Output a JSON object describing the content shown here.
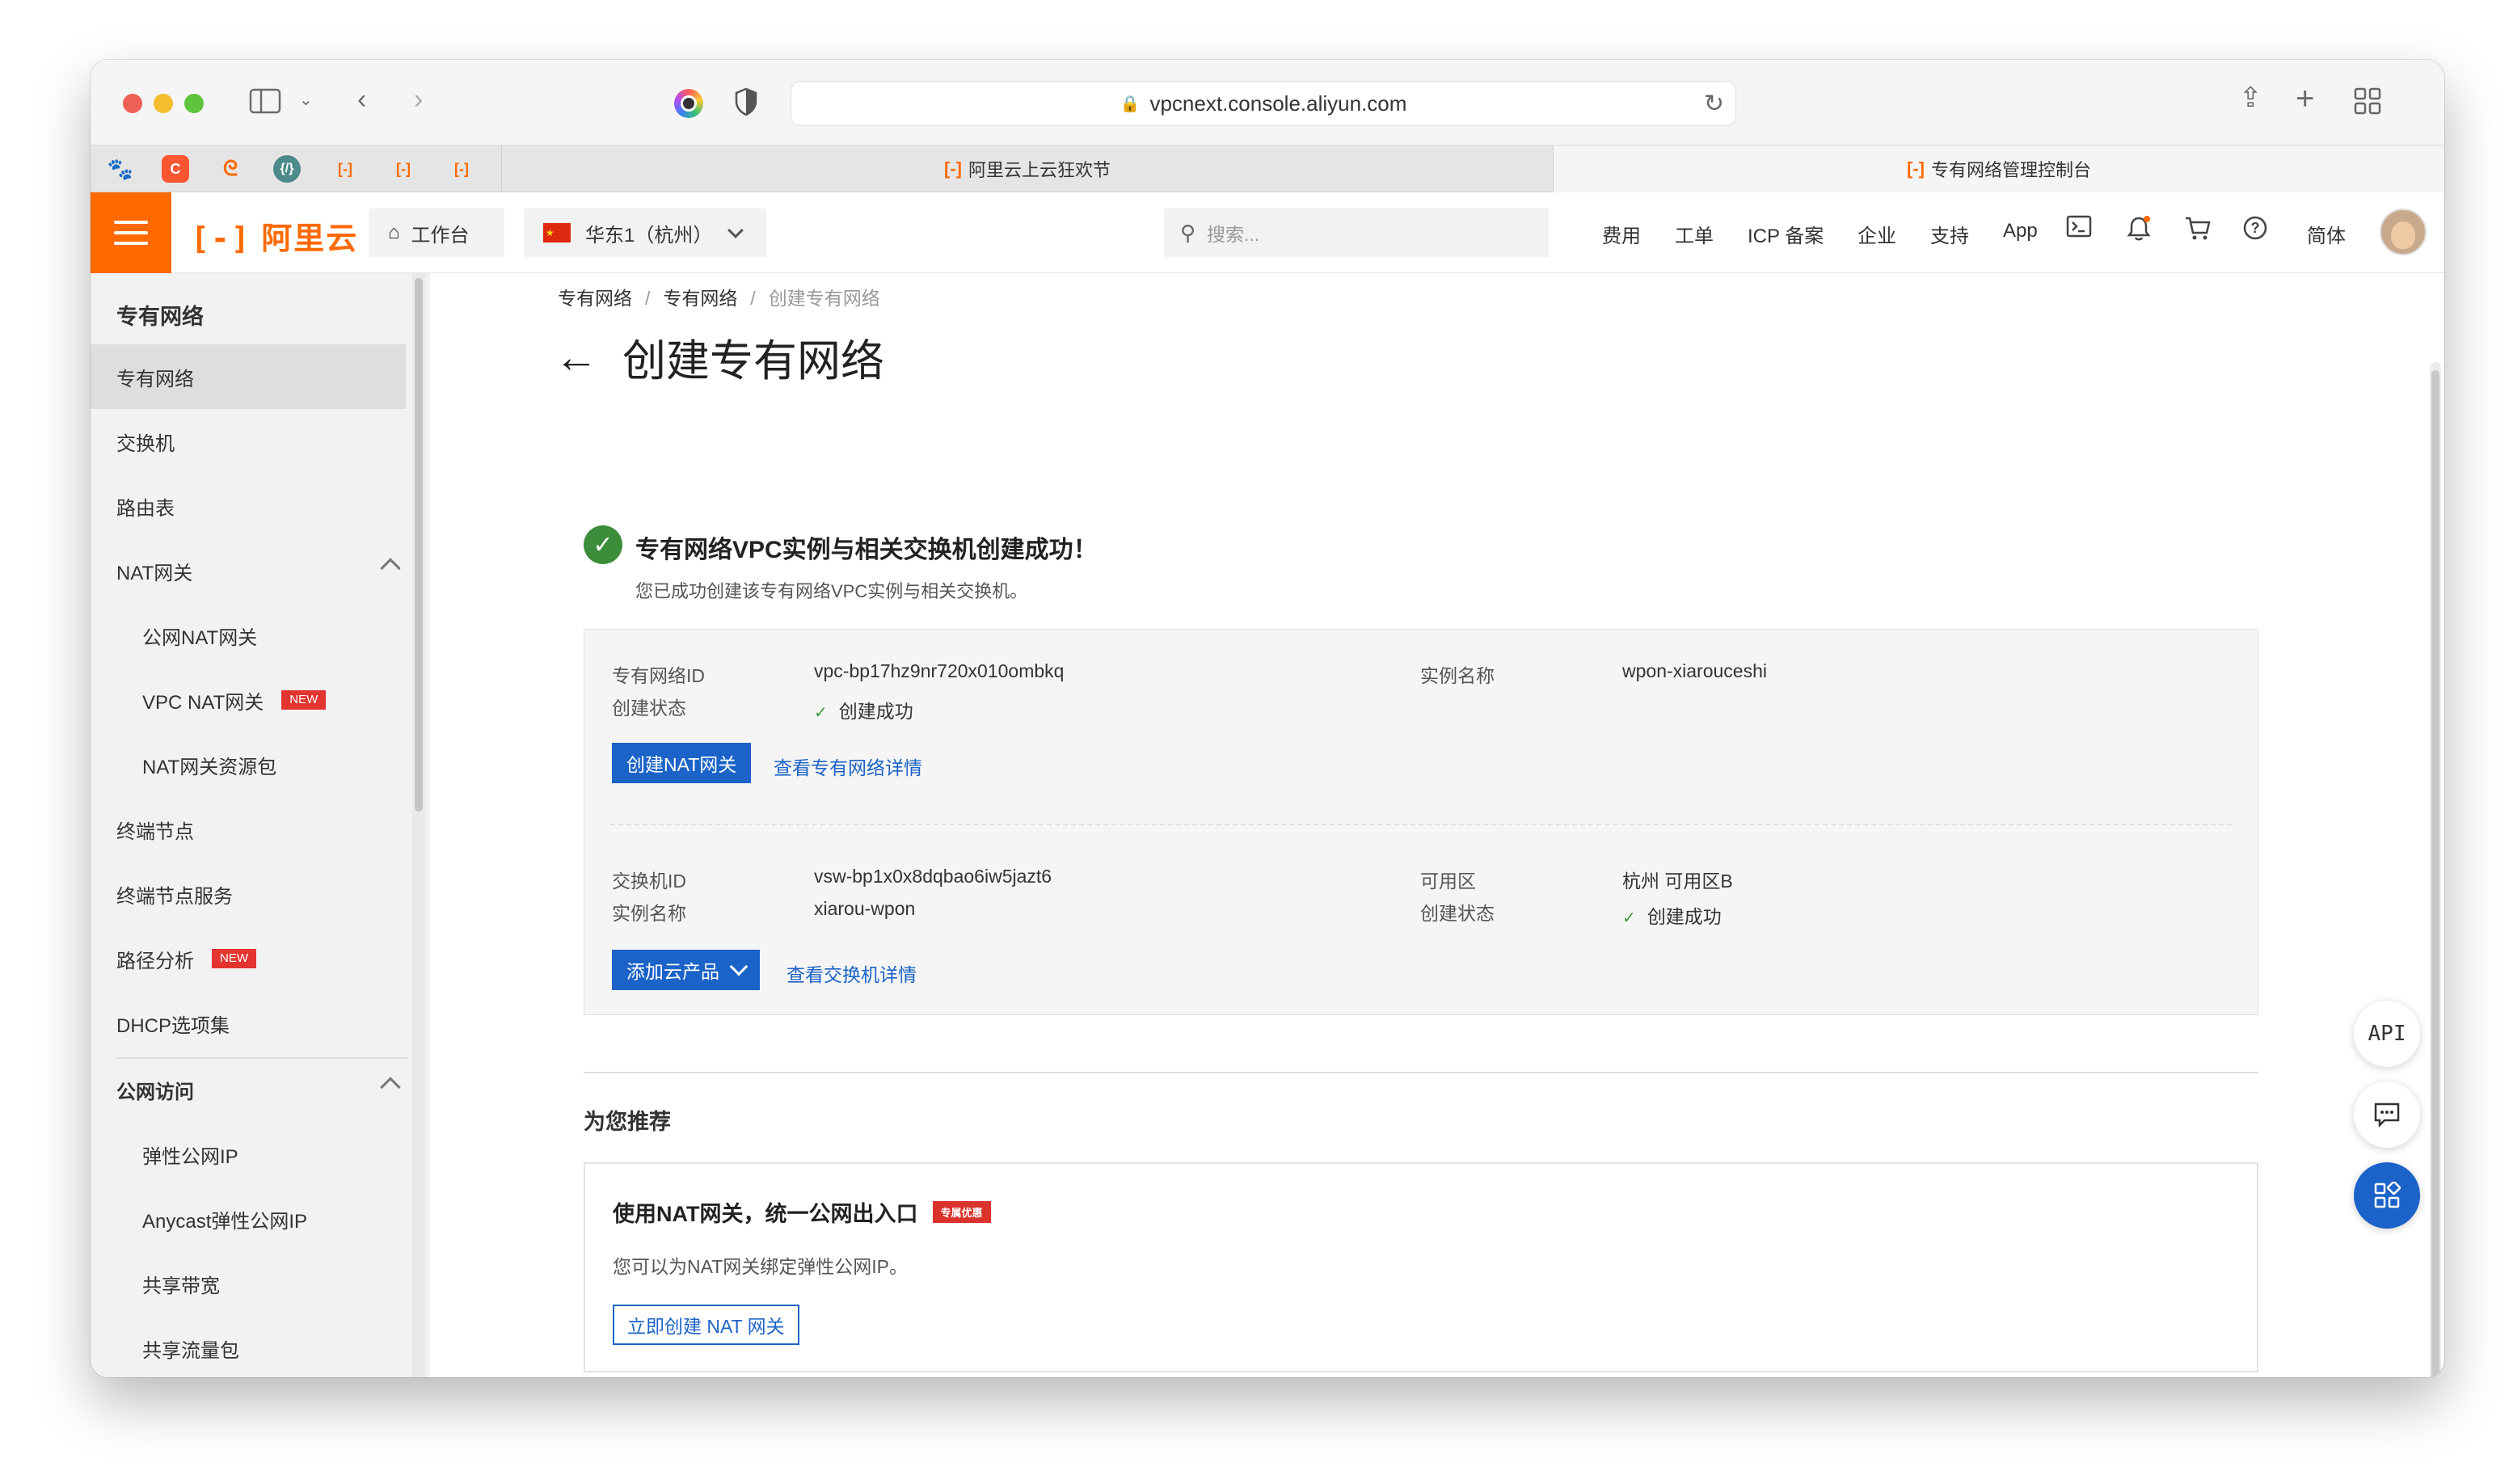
{
  "browser": {
    "url": "vpcnext.console.aliyun.com",
    "tabs": [
      {
        "label": "阿里云上云狂欢节",
        "active": false
      },
      {
        "label": "专有网络管理控制台",
        "active": true
      }
    ]
  },
  "header": {
    "logo": "阿里云",
    "workbench": "工作台",
    "region": "华东1（杭州）",
    "search_placeholder": "搜索...",
    "nav": [
      "费用",
      "工单",
      "ICP 备案",
      "企业",
      "支持",
      "App"
    ],
    "lang": "简体"
  },
  "sidebar": {
    "title": "专有网络",
    "items": [
      {
        "label": "专有网络",
        "level": 0,
        "active": true
      },
      {
        "label": "交换机",
        "level": 0
      },
      {
        "label": "路由表",
        "level": 0
      },
      {
        "label": "NAT网关",
        "level": 0,
        "expandable": true
      },
      {
        "label": "公网NAT网关",
        "level": 1
      },
      {
        "label": "VPC NAT网关",
        "level": 1,
        "badge": "NEW"
      },
      {
        "label": "NAT网关资源包",
        "level": 1
      },
      {
        "label": "终端节点",
        "level": 0
      },
      {
        "label": "终端节点服务",
        "level": 0
      },
      {
        "label": "路径分析",
        "level": 0,
        "badge": "NEW"
      },
      {
        "label": "DHCP选项集",
        "level": 0
      },
      {
        "label": "公网访问",
        "level": 0,
        "expandable": true
      },
      {
        "label": "弹性公网IP",
        "level": 1
      },
      {
        "label": "Anycast弹性公网IP",
        "level": 1
      },
      {
        "label": "共享带宽",
        "level": 1
      },
      {
        "label": "共享流量包",
        "level": 1
      }
    ]
  },
  "breadcrumb": [
    "专有网络",
    "专有网络",
    "创建专有网络"
  ],
  "page": {
    "title": "创建专有网络",
    "success_title": "专有网络VPC实例与相关交换机创建成功！",
    "success_desc": "您已成功创建该专有网络VPC实例与相关交换机。"
  },
  "vpc": {
    "id_label": "专有网络ID",
    "id": "vpc-bp17hz9nr720x010ombkq",
    "status_label": "创建状态",
    "status": "创建成功",
    "name_label": "实例名称",
    "name": "wpon-xiarouceshi",
    "create_nat_button": "创建NAT网关",
    "detail_link": "查看专有网络详情"
  },
  "vswitch": {
    "id_label": "交换机ID",
    "id": "vsw-bp1x0x8dqbao6iw5jazt6",
    "name_label": "实例名称",
    "name": "xiarou-wpon",
    "zone_label": "可用区",
    "zone": "杭州 可用区B",
    "status_label": "创建状态",
    "status": "创建成功",
    "add_product_button": "添加云产品",
    "detail_link": "查看交换机详情"
  },
  "recommend": {
    "title": "为您推荐",
    "card_title": "使用NAT网关，统一公网出入口",
    "badge": "专属优惠",
    "card_desc": "您可以为NAT网关绑定弹性公网IP。",
    "button": "立即创建 NAT 网关"
  },
  "float": {
    "api": "API"
  },
  "colors": {
    "brand": "#ff6a00",
    "primary": "#1b63c8",
    "success": "#3b8d3a",
    "badge": "#e3342f"
  }
}
